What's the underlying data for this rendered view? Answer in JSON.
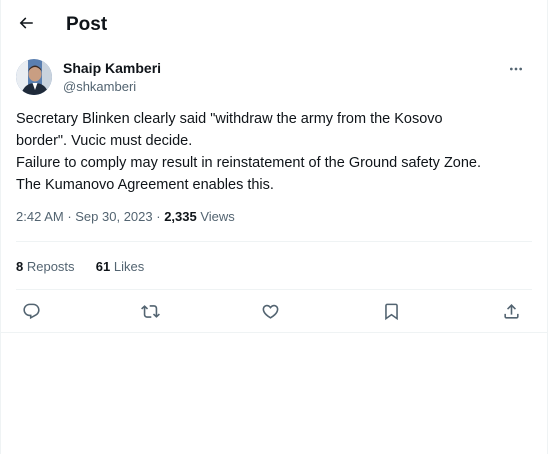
{
  "header": {
    "title": "Post"
  },
  "author": {
    "name": "Shaip Kamberi",
    "handle": "@shkamberi"
  },
  "tweet": {
    "lines": [
      "Secretary Blinken clearly said \"withdraw the army from the Kosovo",
      "border\". Vucic must decide.",
      "Failure to comply may result in reinstatement of the Ground safety Zone.",
      "The Kumanovo Agreement enables this."
    ]
  },
  "meta": {
    "time": "2:42 AM",
    "separator": " · ",
    "date": "Sep 30, 2023",
    "views_count": "2,335",
    "views_label": " Views"
  },
  "stats": {
    "reposts_count": "8",
    "reposts_label": " Reposts",
    "likes_count": "61",
    "likes_label": " Likes"
  },
  "actions": {
    "reply": "reply-icon",
    "repost": "repost-icon",
    "like": "heart-icon",
    "bookmark": "bookmark-icon",
    "share": "share-icon"
  },
  "colors": {
    "text_primary": "#0f1419",
    "text_secondary": "#536471",
    "border": "#eff3f4"
  }
}
